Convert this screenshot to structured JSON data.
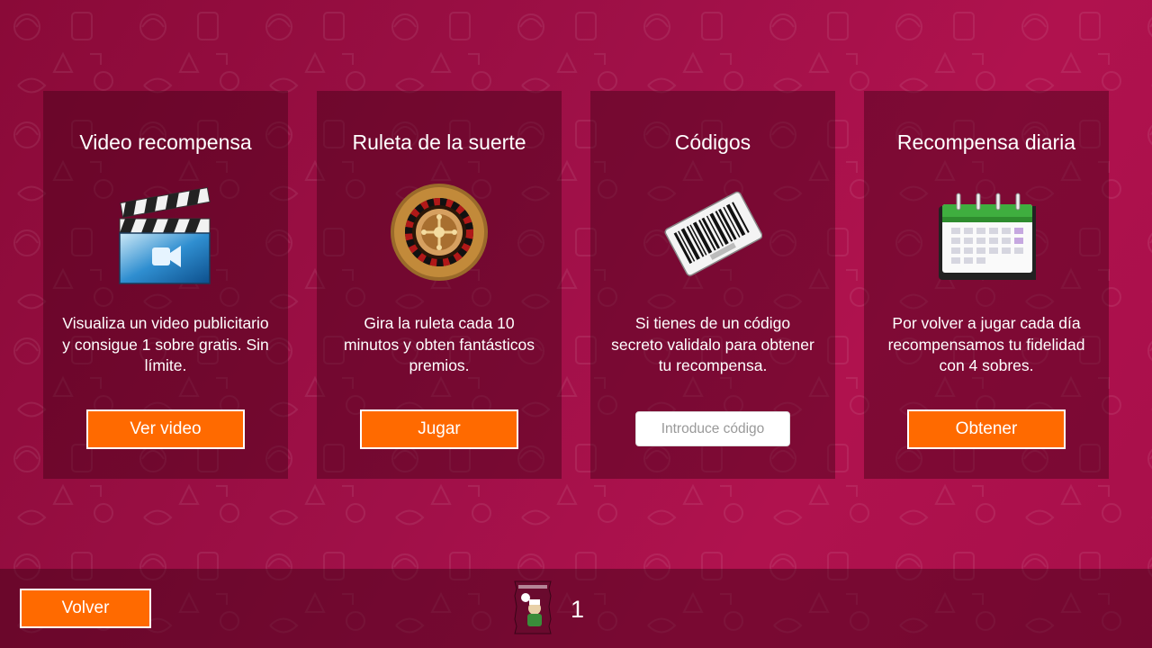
{
  "panels": [
    {
      "id": "video",
      "title": "Video recompensa",
      "icon": "clapperboard-video-icon",
      "description": "Visualiza un video publicitario y consigue 1 sobre gratis. Sin límite.",
      "button_label": "Ver video"
    },
    {
      "id": "roulette",
      "title": "Ruleta de la suerte",
      "icon": "roulette-wheel-icon",
      "description": "Gira la ruleta cada 10 minutos y obten fantásticos premios.",
      "button_label": "Jugar"
    },
    {
      "id": "codes",
      "title": "Códigos",
      "icon": "barcode-icon",
      "description": "Si tienes de un código secreto validalo para obtener tu recompensa.",
      "input_placeholder": "Introduce código"
    },
    {
      "id": "daily",
      "title": "Recompensa diaria",
      "icon": "calendar-icon",
      "description": "Por volver a jugar cada día recompensamos tu fidelidad con 4 sobres.",
      "button_label": "Obtener"
    }
  ],
  "footer": {
    "back_label": "Volver",
    "pack_icon": "card-pack-icon",
    "pack_count": "1"
  },
  "colors": {
    "accent_button": "#ff6a00",
    "background": "#a01048"
  }
}
